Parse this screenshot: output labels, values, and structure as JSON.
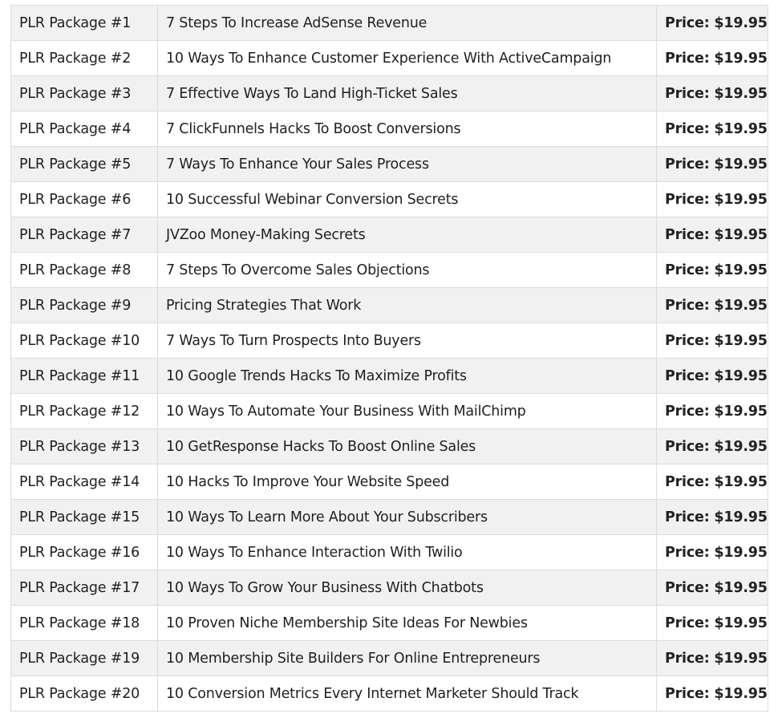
{
  "table": {
    "rows": [
      {
        "package": "PLR Package #1",
        "title": "7 Steps To Increase AdSense Revenue",
        "price": "Price: $19.95"
      },
      {
        "package": "PLR Package #2",
        "title": "10 Ways To Enhance Customer Experience With ActiveCampaign",
        "price": "Price: $19.95"
      },
      {
        "package": "PLR Package #3",
        "title": "7 Effective Ways To Land High-Ticket Sales",
        "price": "Price: $19.95"
      },
      {
        "package": "PLR Package #4",
        "title": "7 ClickFunnels Hacks To Boost Conversions",
        "price": "Price: $19.95"
      },
      {
        "package": "PLR Package #5",
        "title": "7 Ways To Enhance Your Sales Process",
        "price": "Price: $19.95"
      },
      {
        "package": "PLR Package #6",
        "title": "10 Successful Webinar Conversion Secrets",
        "price": "Price: $19.95"
      },
      {
        "package": "PLR Package #7",
        "title": "JVZoo Money-Making Secrets",
        "price": "Price: $19.95"
      },
      {
        "package": "PLR Package #8",
        "title": "7 Steps To Overcome Sales Objections",
        "price": "Price: $19.95"
      },
      {
        "package": "PLR Package #9",
        "title": "Pricing Strategies That Work",
        "price": "Price: $19.95"
      },
      {
        "package": "PLR Package #10",
        "title": "7 Ways To Turn Prospects Into Buyers",
        "price": "Price: $19.95"
      },
      {
        "package": "PLR Package #11",
        "title": "10 Google Trends Hacks To Maximize Profits",
        "price": "Price: $19.95"
      },
      {
        "package": "PLR Package #12",
        "title": "10 Ways To Automate Your Business With MailChimp",
        "price": "Price: $19.95"
      },
      {
        "package": "PLR Package #13",
        "title": "10 GetResponse Hacks To Boost Online Sales",
        "price": "Price: $19.95"
      },
      {
        "package": "PLR Package #14",
        "title": "10 Hacks To Improve Your Website Speed",
        "price": "Price: $19.95"
      },
      {
        "package": "PLR Package #15",
        "title": "10 Ways To Learn More About Your Subscribers",
        "price": "Price: $19.95"
      },
      {
        "package": "PLR Package #16",
        "title": "10 Ways To Enhance Interaction With Twilio",
        "price": "Price: $19.95"
      },
      {
        "package": "PLR Package #17",
        "title": "10 Ways To Grow Your Business With Chatbots",
        "price": "Price: $19.95"
      },
      {
        "package": "PLR Package #18",
        "title": "10 Proven Niche Membership Site Ideas For Newbies",
        "price": "Price: $19.95"
      },
      {
        "package": "PLR Package #19",
        "title": "10 Membership Site Builders For Online Entrepreneurs",
        "price": "Price: $19.95"
      },
      {
        "package": "PLR Package #20",
        "title": "10 Conversion Metrics Every Internet Marketer Should Track",
        "price": "Price: $19.95"
      }
    ]
  },
  "colors": {
    "row_alt": "#f1f1f1",
    "row_base": "#ffffff",
    "border": "#dcdcdc",
    "text": "#1f1f1f"
  }
}
